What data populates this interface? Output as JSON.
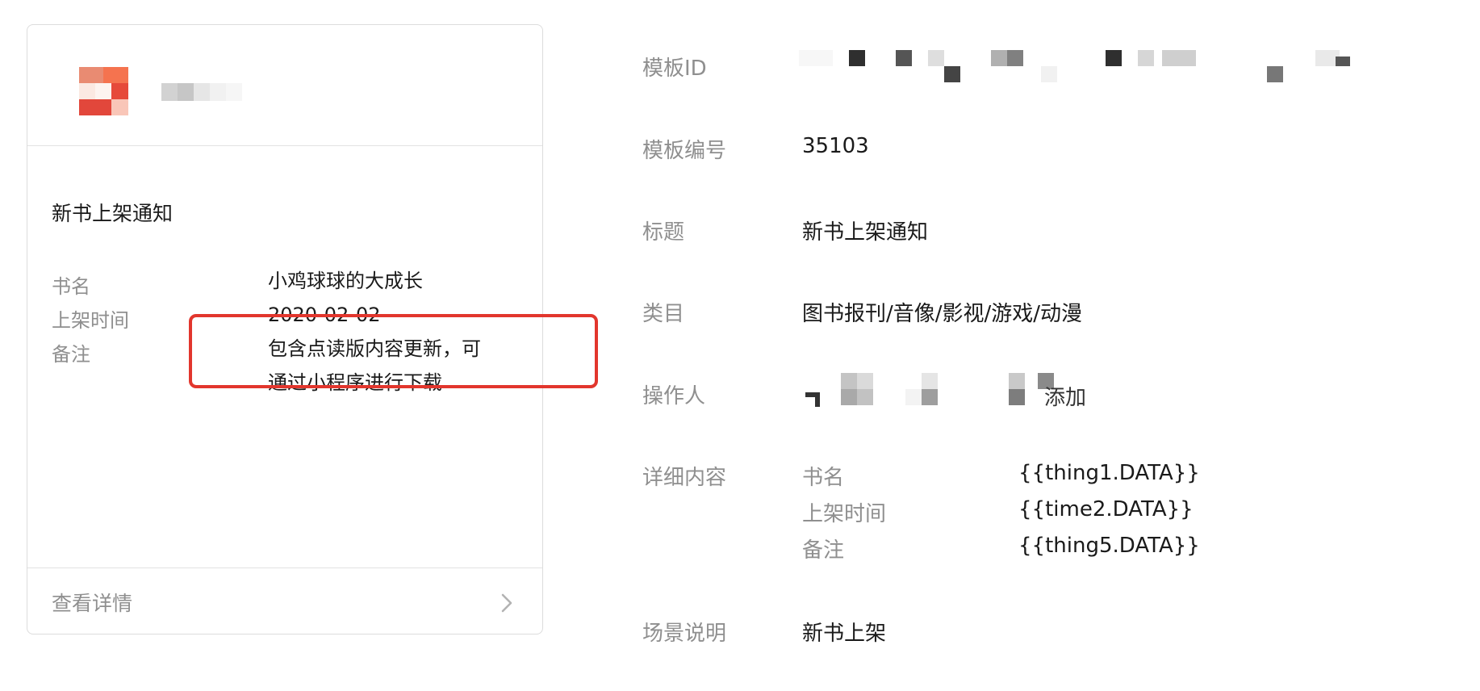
{
  "preview_card": {
    "title": "新书上架通知",
    "fields": [
      {
        "label": "书名",
        "value": "小鸡球球的大成长"
      },
      {
        "label": "上架时间",
        "value": "2020-02-02"
      },
      {
        "label": "备注",
        "value_lines": [
          "包含点读版内容更新，可",
          "通过小程序进行下载"
        ]
      }
    ],
    "footer_label": "查看详情",
    "footer_icon": "chevron-right-icon"
  },
  "details": {
    "template_id_label": "模板ID",
    "template_no_label": "模板编号",
    "template_no_value": "35103",
    "title_label": "标题",
    "title_value": "新书上架通知",
    "category_label": "类目",
    "category_value": "图书报刊/音像/影视/游戏/动漫",
    "operator_label": "操作人",
    "operator_partial": "添加",
    "content_label": "详细内容",
    "content_rows": [
      {
        "label": "书名",
        "value": "{{thing1.DATA}}"
      },
      {
        "label": "上架时间",
        "value": "{{time2.DATA}}"
      },
      {
        "label": "备注",
        "value": "{{thing5.DATA}}"
      }
    ],
    "scene_label": "场景说明",
    "scene_value": "新书上架"
  },
  "colors": {
    "highlight": "#e2362d",
    "label_gray": "#8f8f8f",
    "text": "#1a1a1a",
    "border": "#dcdcdc"
  }
}
